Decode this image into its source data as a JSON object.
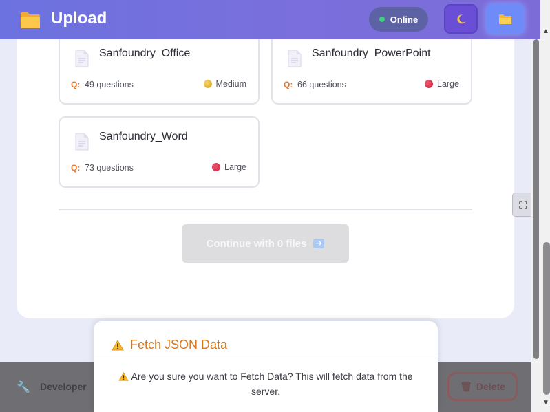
{
  "header": {
    "title": "Upload",
    "status": "Online",
    "status_color": "#3ad27a",
    "theme_icon": "moon-icon",
    "folder_icon": "folder-icon"
  },
  "files": [
    {
      "name": "Sanfoundry_Office",
      "q_label": "Q:",
      "questions": "49 questions",
      "size": "Medium",
      "size_color": "#e0b030"
    },
    {
      "name": "Sanfoundry_PowerPoint",
      "q_label": "Q:",
      "questions": "66 questions",
      "size": "Large",
      "size_color": "#d42240"
    },
    {
      "name": "Sanfoundry_Word",
      "q_label": "Q:",
      "questions": "73 questions",
      "size": "Large",
      "size_color": "#d42240"
    }
  ],
  "continue_button": {
    "label": "Continue with 0 files",
    "icon": "arrow-right-icon"
  },
  "bottom_bar": {
    "label": "Developer",
    "delete_label": "Delete"
  },
  "modal": {
    "title": "Fetch JSON Data",
    "message": "Are you sure you want to Fetch Data? This will fetch data from the server.",
    "icon": "warning-icon",
    "accent_color": "#d3771a"
  },
  "fullscreen_icon": "fullscreen-icon"
}
